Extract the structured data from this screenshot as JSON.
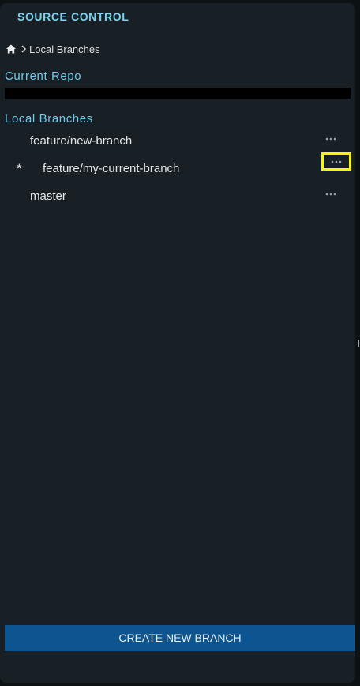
{
  "panel": {
    "title": "SOURCE CONTROL"
  },
  "breadcrumb": {
    "home_icon": "home-icon",
    "separator_icon": "chevron-right-icon",
    "current": "Local Branches"
  },
  "current_repo": {
    "label": "Current Repo",
    "path": ""
  },
  "local_branches": {
    "label": "Local Branches",
    "more_icon": "ellipsis-icon",
    "current_marker": "*",
    "items": [
      {
        "name": "feature/new-branch",
        "current": false
      },
      {
        "name": "feature/my-current-branch",
        "current": true
      },
      {
        "name": "master",
        "current": false
      }
    ]
  },
  "actions": {
    "create_label": "CREATE NEW BRANCH"
  },
  "colors": {
    "background": "#0c1114",
    "panel": "#182025",
    "accent": "#6ccbea",
    "button": "#0d5590",
    "highlight": "#f7f700"
  }
}
